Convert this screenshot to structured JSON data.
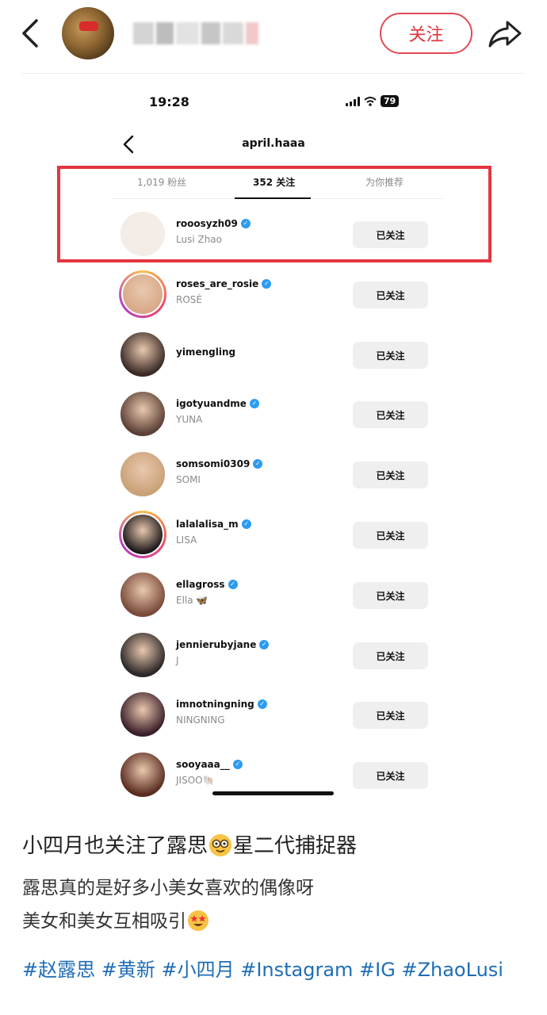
{
  "header": {
    "follow_label": "关注"
  },
  "status_bar": {
    "time": "19:28",
    "battery": "79"
  },
  "ig": {
    "title": "april.haaa",
    "tabs": [
      {
        "label": "1,019 粉丝"
      },
      {
        "label": "352 关注"
      },
      {
        "label": "为你推荐"
      }
    ],
    "rows": [
      {
        "username": "rooosyzh09",
        "name": "Lusi Zhao",
        "verified": true,
        "story": false,
        "button": "已关注",
        "avatar_color": "#f4ece6"
      },
      {
        "username": "roses_are_rosie",
        "name": "ROSÉ",
        "verified": true,
        "story": true,
        "button": "已关注",
        "avatar_color": "#d8a989"
      },
      {
        "username": "yimengling",
        "name": "",
        "verified": false,
        "story": false,
        "button": "已关注",
        "avatar_color": "#3a2a26"
      },
      {
        "username": "igotyuandme",
        "name": "YUNA",
        "verified": true,
        "story": false,
        "button": "已关注",
        "avatar_color": "#5b4036"
      },
      {
        "username": "somsomi0309",
        "name": "SOMI",
        "verified": true,
        "story": false,
        "button": "已关注",
        "avatar_color": "#c9a177"
      },
      {
        "username": "lalalalisa_m",
        "name": "LISA",
        "verified": true,
        "story": true,
        "button": "已关注",
        "avatar_color": "#1e1a1c"
      },
      {
        "username": "ellagross",
        "name": "Ella 🦋",
        "verified": true,
        "story": false,
        "button": "已关注",
        "avatar_color": "#7a4b3a"
      },
      {
        "username": "jennierubyjane",
        "name": "J",
        "verified": true,
        "story": false,
        "button": "已关注",
        "avatar_color": "#2c2728"
      },
      {
        "username": "imnotningning",
        "name": "NINGNING",
        "verified": true,
        "story": false,
        "button": "已关注",
        "avatar_color": "#3b1f2a"
      },
      {
        "username": "sooyaaa__",
        "name": "JISOO🐚",
        "verified": true,
        "story": false,
        "button": "已关注",
        "avatar_color": "#5a2c20"
      }
    ]
  },
  "post": {
    "title_a": "小四月也关注了露思",
    "title_b": "星二代捕捉器",
    "line1": "露思真的是好多小美女喜欢的偶像呀",
    "line2": "美女和美女互相吸引",
    "tags": "#赵露思 #黄新 #小四月 #Instagram #IG #ZhaoLusi"
  },
  "colors": {
    "accent_red": "#e0333f",
    "highlight": "#e4363f",
    "hashtag": "#1f6db5",
    "verified": "#2d9bf0"
  },
  "icons": [
    "back-arrow-icon",
    "share-icon",
    "verified-icon",
    "signal-icon",
    "wifi-icon",
    "battery-icon",
    "nerd-face-emoji",
    "star-struck-emoji"
  ]
}
